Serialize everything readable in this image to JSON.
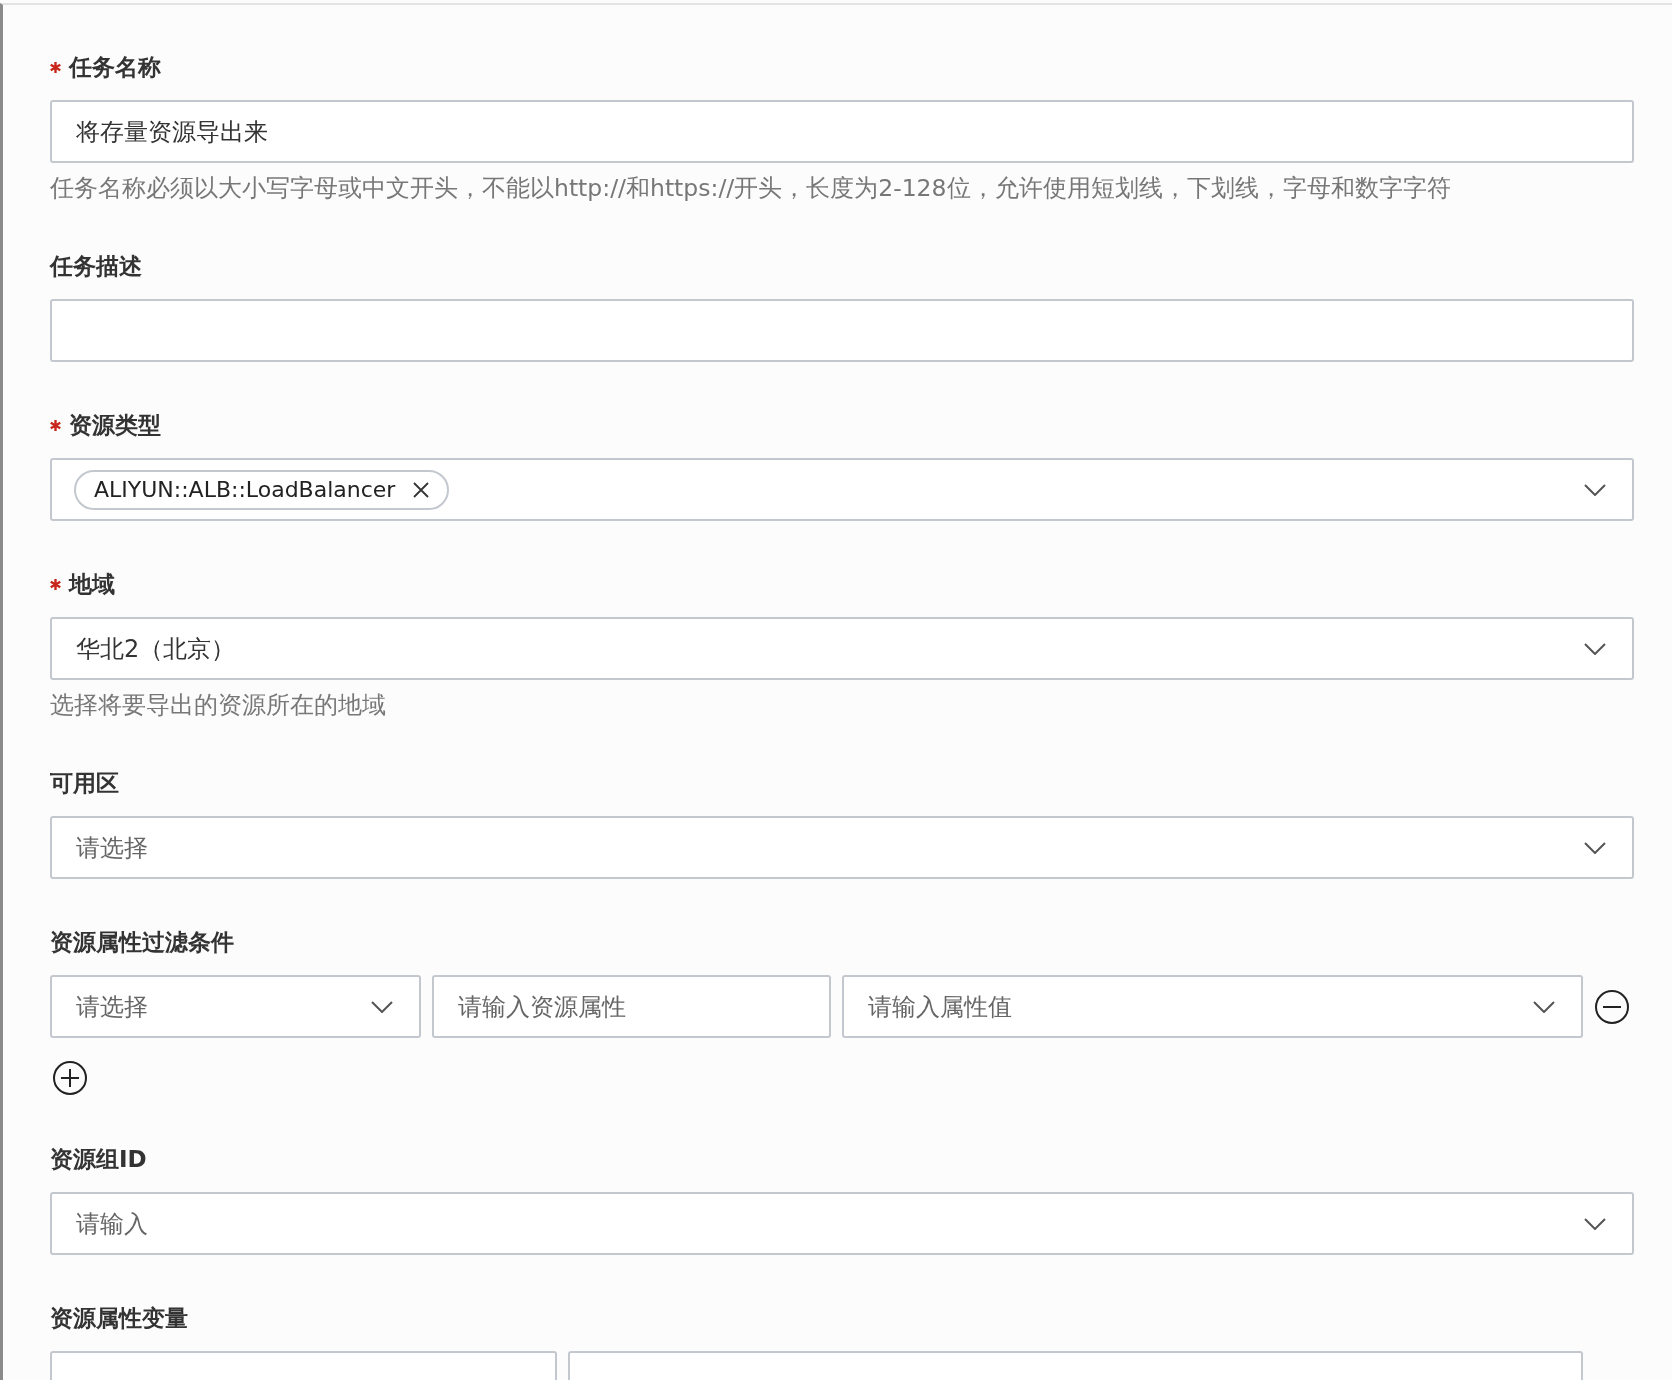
{
  "form": {
    "fields": [
      {
        "kind": "input",
        "label": "任务名称",
        "required": true,
        "value": "将存量资源导出来",
        "hint": "任务名称必须以大小写字母或中文开头，不能以http://和https://开头，长度为2-128位，允许使用短划线，下划线，字母和数字字符"
      },
      {
        "kind": "input",
        "label": "任务描述",
        "required": false
      },
      {
        "kind": "tags",
        "label": "资源类型",
        "required": true,
        "tags": [
          "ALIYUN::ALB::LoadBalancer"
        ]
      },
      {
        "kind": "select",
        "label": "地域",
        "required": true,
        "value": "华北2（北京）",
        "hint": "选择将要导出的资源所在的地域"
      },
      {
        "kind": "select",
        "label": "可用区",
        "required": false,
        "placeholder": "请选择"
      },
      {
        "kind": "filters",
        "label": "资源属性过滤条件",
        "required": false,
        "rows": [
          {
            "operator_placeholder": "请选择",
            "property_placeholder": "请输入资源属性",
            "value_placeholder": "请输入属性值"
          }
        ]
      },
      {
        "kind": "select",
        "label": "资源组ID",
        "required": false,
        "placeholder": "请输入"
      },
      {
        "kind": "pair",
        "label": "资源属性变量",
        "required": false
      }
    ]
  }
}
